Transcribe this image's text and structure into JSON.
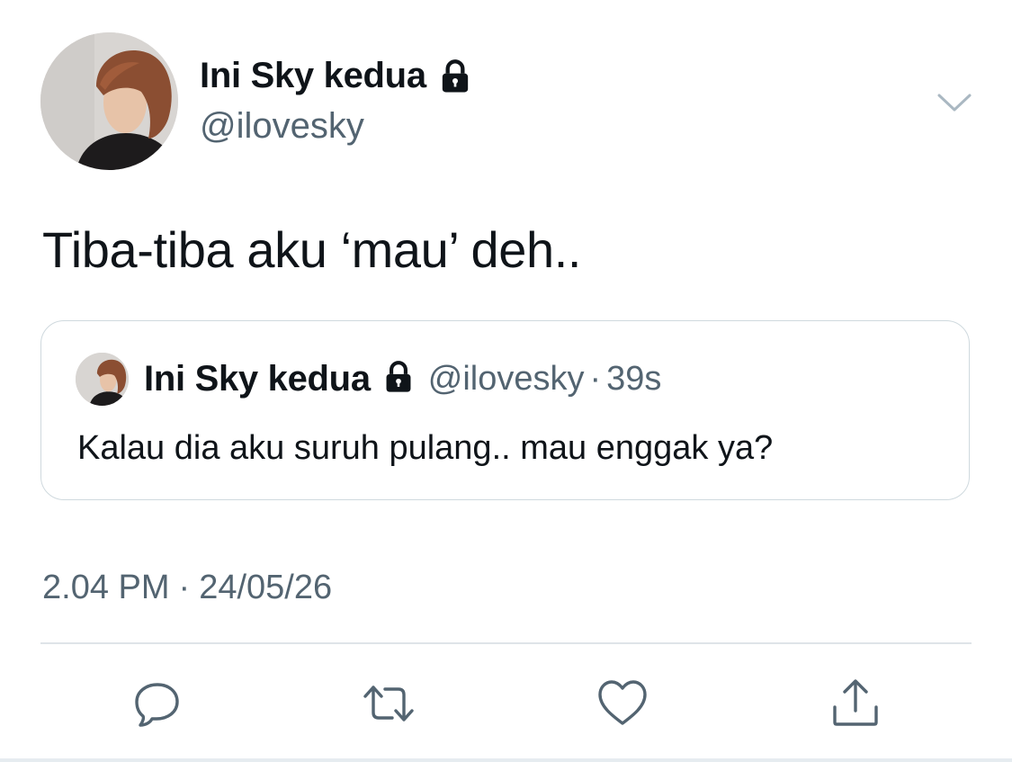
{
  "author": {
    "display_name": "Ini Sky kedua",
    "handle": "@ilovesky",
    "protected_icon": "lock-icon",
    "avatar": "profile photo"
  },
  "tweet": {
    "text": "Tiba-tiba aku ‘mau’ deh..",
    "time": "2.04 PM",
    "separator": "·",
    "date": "24/05/26"
  },
  "quoted_tweet": {
    "display_name": "Ini Sky kedua",
    "handle": "@ilovesky",
    "separator": "·",
    "age": "39s",
    "text": "Kalau dia aku suruh pulang.. mau enggak ya?"
  },
  "actions": [
    {
      "icon": "reply-icon"
    },
    {
      "icon": "retweet-icon"
    },
    {
      "icon": "like-icon"
    },
    {
      "icon": "share-icon"
    }
  ],
  "colors": {
    "text_primary": "#0f1419",
    "text_secondary": "#536471",
    "border": "#cfd9de"
  }
}
